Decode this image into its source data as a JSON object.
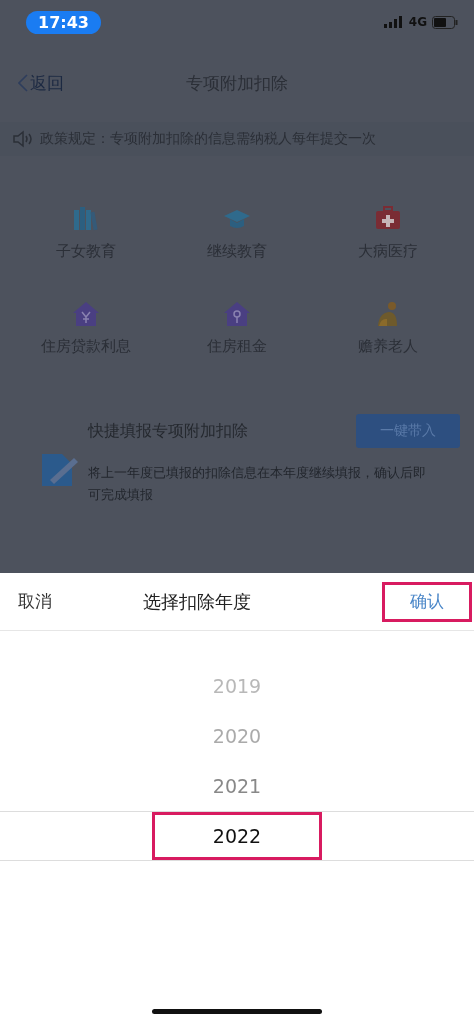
{
  "status_bar": {
    "time": "17:43",
    "network": "4G"
  },
  "nav": {
    "back": "返回",
    "title": "专项附加扣除"
  },
  "notice": "政策规定：专项附加扣除的信息需纳税人每年提交一次",
  "categories": [
    {
      "label": "子女教育",
      "kind": "books"
    },
    {
      "label": "继续教育",
      "kind": "cap"
    },
    {
      "label": "大病医疗",
      "kind": "medkit"
    },
    {
      "label": "住房贷款利息",
      "kind": "house-yen"
    },
    {
      "label": "住房租金",
      "kind": "house-key"
    },
    {
      "label": "赡养老人",
      "kind": "elder"
    }
  ],
  "quick_fill": {
    "title": "快捷填报专项附加扣除",
    "button": "一键带入",
    "description": "将上一年度已填报的扣除信息在本年度继续填报，确认后即可完成填报"
  },
  "picker": {
    "cancel": "取消",
    "title": "选择扣除年度",
    "confirm": {
      "label": "确认",
      "highlighted": true
    },
    "years": [
      {
        "label": "2019",
        "selected": false,
        "highlighted": false
      },
      {
        "label": "2020",
        "selected": false,
        "highlighted": false
      },
      {
        "label": "2021",
        "selected": false,
        "highlighted": false
      },
      {
        "label": "2022",
        "selected": true,
        "highlighted": true
      }
    ]
  }
}
